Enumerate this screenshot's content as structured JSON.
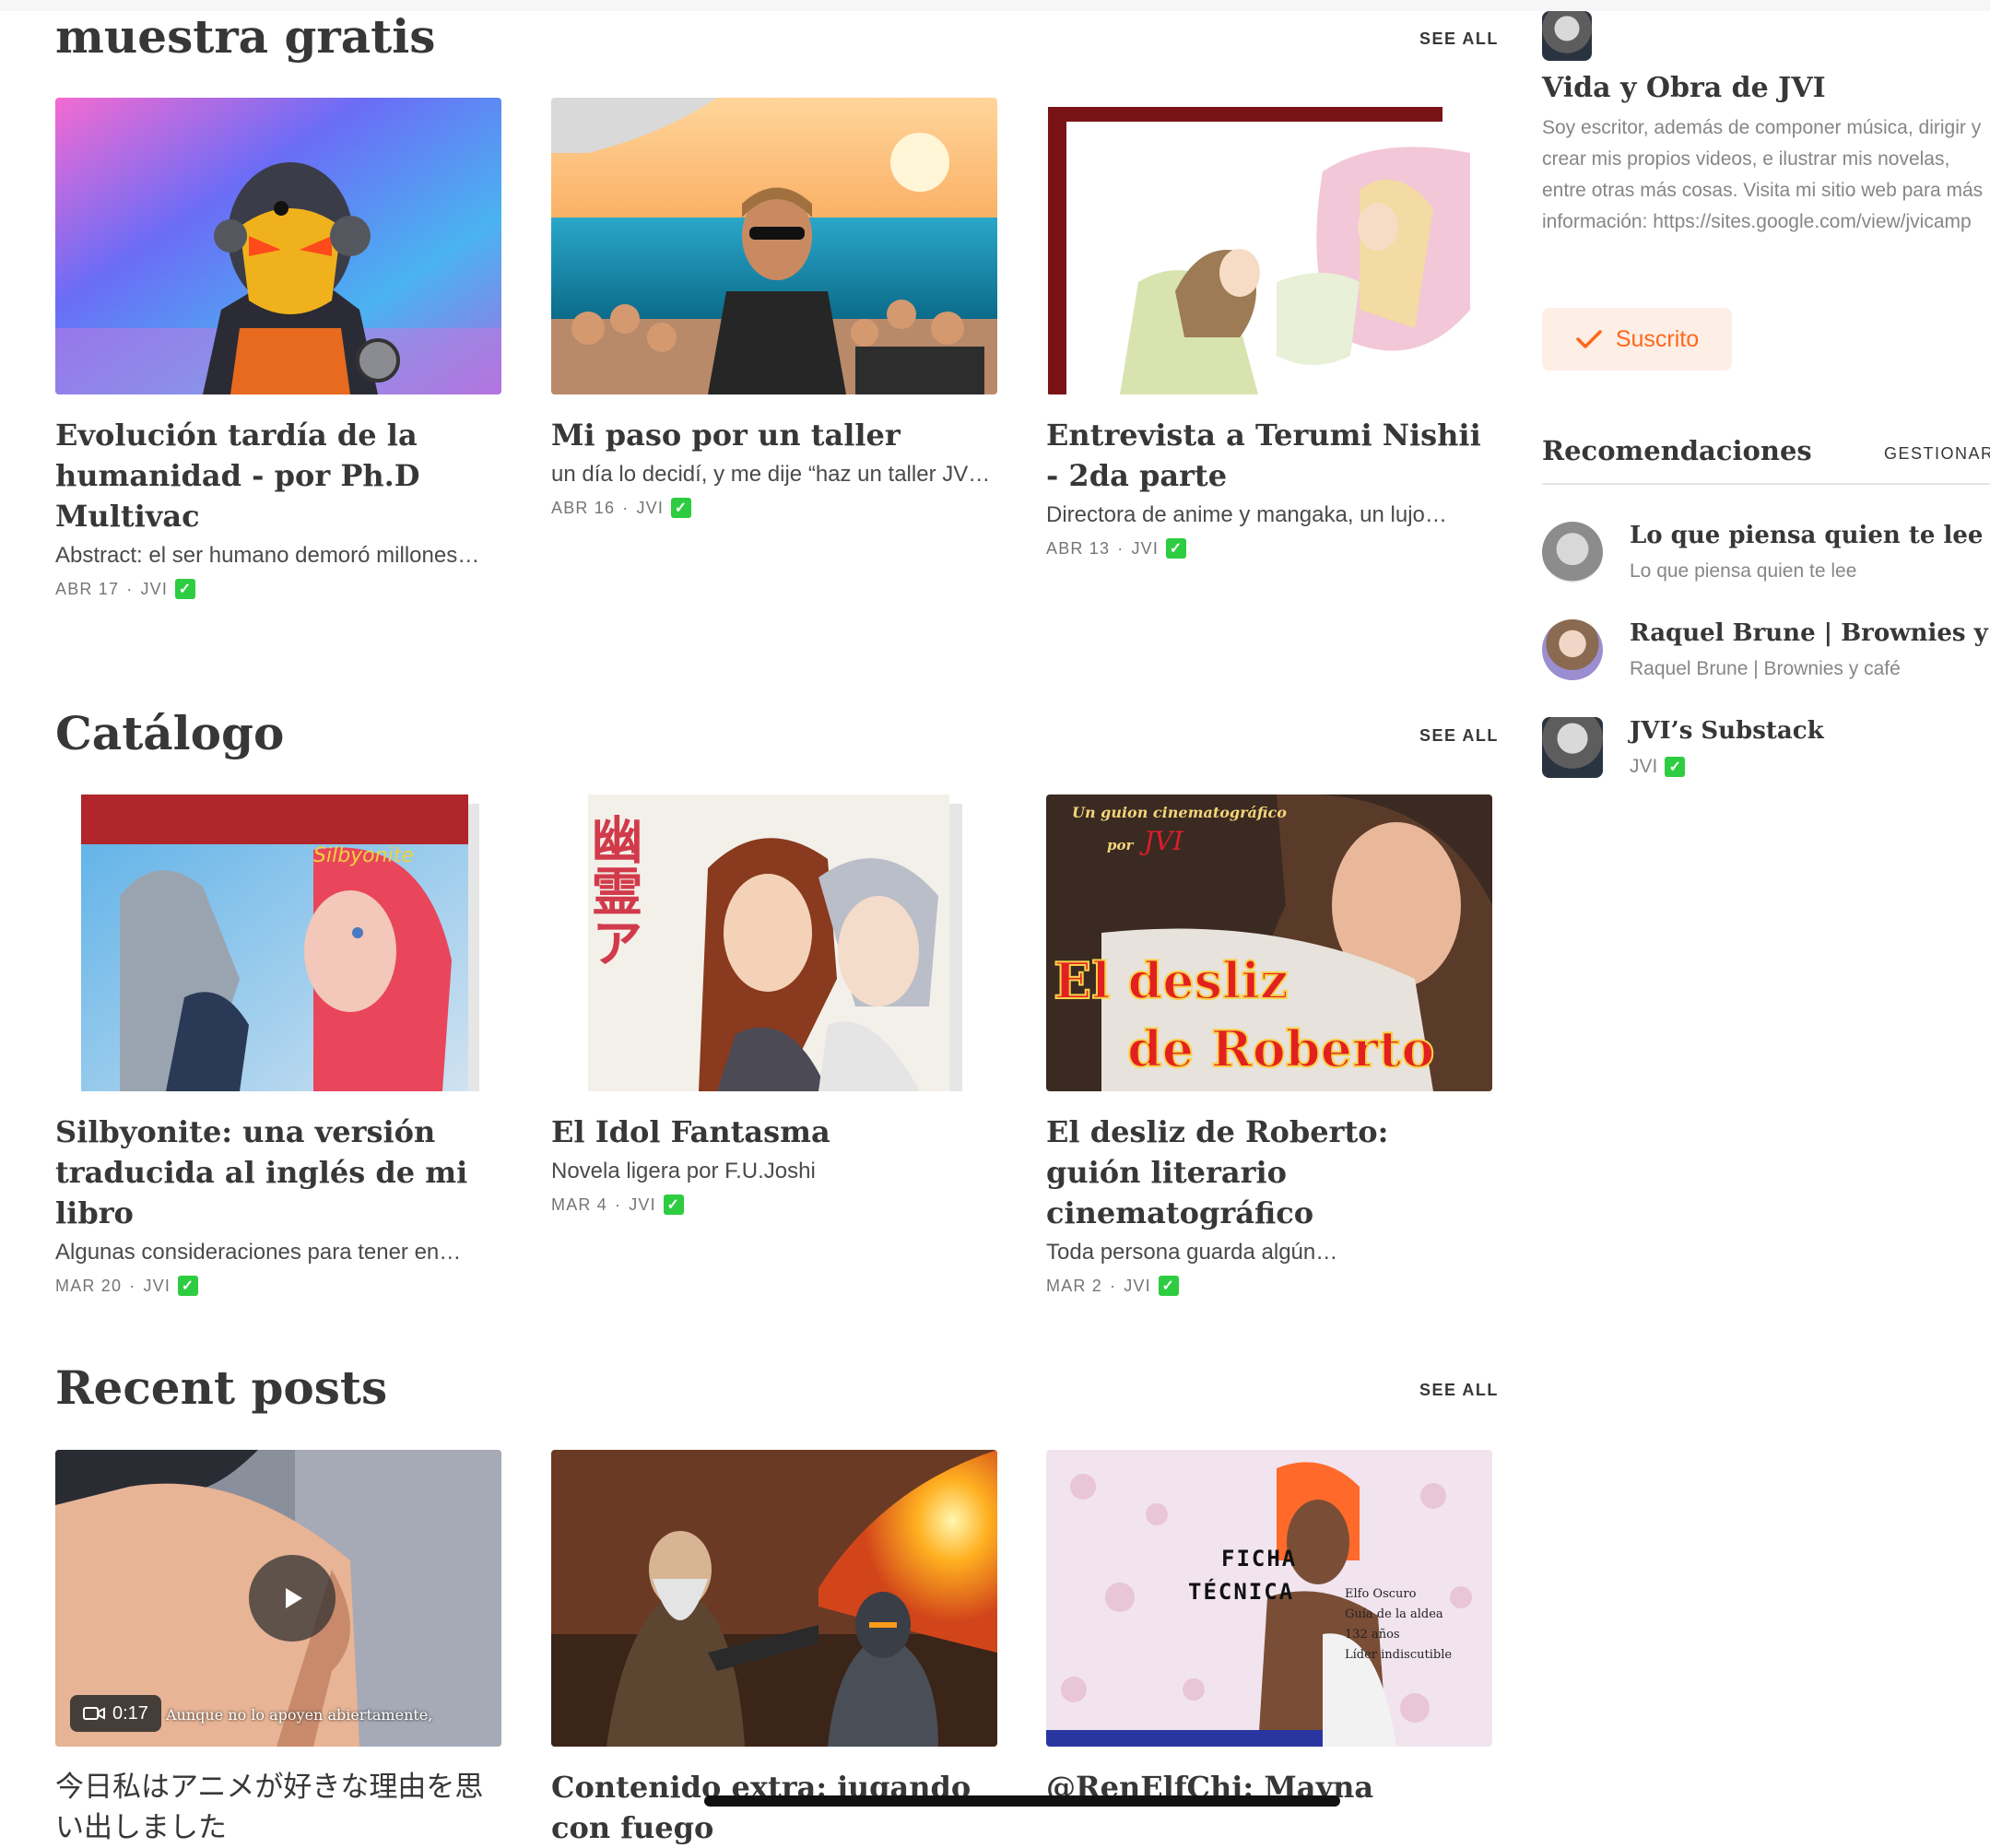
{
  "sections": {
    "muestra": {
      "title": "muestra gratis",
      "see_all": "SEE ALL",
      "posts": [
        {
          "title": "Evolución tardía de la humanidad - por Ph.D Multivac",
          "subtitle": "Abstract: el ser humano demoró millones…",
          "date": "ABR 17",
          "author": "JVI"
        },
        {
          "title": "Mi paso por un taller",
          "subtitle": "un día lo decidí, y me dije “haz un taller JV…",
          "date": "ABR 16",
          "author": "JVI"
        },
        {
          "title": "Entrevista a Terumi Nishii - 2da parte",
          "subtitle": "Directora de anime y mangaka, un lujo…",
          "date": "ABR 13",
          "author": "JVI"
        }
      ]
    },
    "catalogo": {
      "title": "Catálogo",
      "see_all": "SEE ALL",
      "posts": [
        {
          "title": "Silbyonite: una versión traducida al inglés de mi libro",
          "subtitle": "Algunas consideraciones para tener en…",
          "date": "MAR 20",
          "author": "JVI",
          "cover_text": "Silbyonite"
        },
        {
          "title": "El Idol Fantasma",
          "subtitle": "Novela ligera por F.U.Joshi",
          "date": "MAR 4",
          "author": "JVI",
          "cover_text": "幽霊ア"
        },
        {
          "title": "El desliz de Roberto: guión literario cinematográfico",
          "subtitle": "Toda persona guarda algún…",
          "date": "MAR 2",
          "author": "JVI",
          "cover_top": "Un guion cinematográfico",
          "cover_by": "por",
          "cover_jvi": "JVI",
          "cover_line1": "El desliz",
          "cover_line2": "de Roberto"
        }
      ]
    },
    "recent": {
      "title": "Recent posts",
      "see_all": "SEE ALL",
      "posts": [
        {
          "title": "今日私はアニメが好きな理由を思い出しました",
          "duration": "0:17",
          "caption": "Aunque no lo apoyen abiertamente,"
        },
        {
          "title": "Contenido extra: jugando con fuego"
        },
        {
          "title": "@RenElfChi: Mayna",
          "cover_title1": "FICHA",
          "cover_title2": "TÉCNICA",
          "cover_lines": [
            "Elfo Oscuro",
            "Guía de la aldea",
            "132 años",
            "Líder indiscutible"
          ]
        }
      ]
    }
  },
  "sidebar": {
    "author_name": "Vida y Obra de JVI",
    "author_desc": "Soy escritor, además de componer música, dirigir y crear mis propios videos, e ilustrar mis novelas, entre otras más cosas. Visita mi sitio web para más información: https://sites.google.com/view/jvicamp",
    "subscribe_label": "Suscrito",
    "recommendations_title": "Recomendaciones",
    "manage_label": "GESTIONAR",
    "recommendations": [
      {
        "name": "Lo que piensa quien te lee",
        "sub": "Lo que piensa quien te lee"
      },
      {
        "name": "Raquel Brune | Brownies y café",
        "sub": "Raquel Brune | Brownies y café"
      },
      {
        "name": "JVI’s Substack",
        "sub": "JVI"
      }
    ]
  },
  "meta_separator": "·",
  "colors": {
    "accent": "#ff6719",
    "text": "#363737",
    "muted": "#868686",
    "check": "#2ecc40"
  }
}
